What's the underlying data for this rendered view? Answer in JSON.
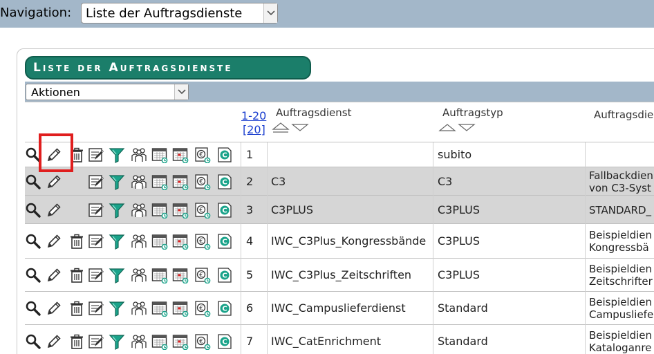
{
  "navigation": {
    "label": "Navigation:",
    "selected": "Liste der Auftragsdienste"
  },
  "panel": {
    "title": "Liste der Auftragsdienste"
  },
  "actions": {
    "selected": "Aktionen"
  },
  "header": {
    "range_link": "1-20",
    "count_link": "[20]",
    "col_service": "Auftragsdienst",
    "col_type": "Auftragstyp",
    "col_desc": "Auftragsdie"
  },
  "rows": [
    {
      "nr": "1",
      "service": "",
      "type": "subito",
      "desc1": "",
      "desc2": "",
      "has_delete": true,
      "has_view_edit": true
    },
    {
      "nr": "2",
      "service": "C3",
      "type": "C3",
      "desc1": "Fallbackdien",
      "desc2": "von C3-Syst",
      "has_delete": false
    },
    {
      "nr": "3",
      "service": "C3PLUS",
      "type": "C3PLUS",
      "desc1": "STANDARD_",
      "desc2": "",
      "has_delete": false
    },
    {
      "nr": "4",
      "service": "IWC_C3Plus_Kongressbände",
      "type": "C3PLUS",
      "desc1": "Beispieldien",
      "desc2": "Kongressbä",
      "has_delete": true
    },
    {
      "nr": "5",
      "service": "IWC_C3Plus_Zeitschriften",
      "type": "C3PLUS",
      "desc1": "Beispieldien",
      "desc2": "Zeitschrifter",
      "has_delete": true
    },
    {
      "nr": "6",
      "service": "IWC_Campuslieferdienst",
      "type": "Standard",
      "desc1": "Beispieldien",
      "desc2": "Campusliefer",
      "has_delete": true
    },
    {
      "nr": "7",
      "service": "IWC_CatEnrichment",
      "type": "Standard",
      "desc1": "Beispieldien",
      "desc2": "Kataloganre",
      "has_delete": true
    }
  ],
  "colors": {
    "topbar": "#a3b7c9",
    "title_pill": "#1b7e6a",
    "grey_row": "#d6d6d6",
    "link": "#1a3ecf",
    "highlight": "#e01e1e"
  }
}
